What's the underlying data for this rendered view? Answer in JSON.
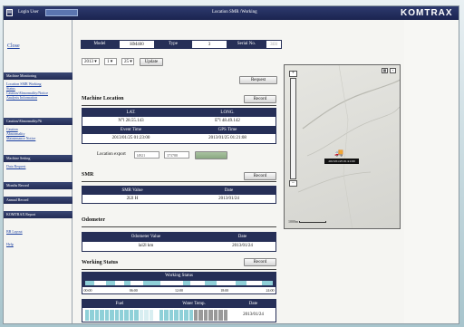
{
  "topbar": {
    "login_label": "Login User",
    "user_value": "",
    "title": "Location SMR /Working",
    "logo": "KOMTRAX"
  },
  "sidebar": {
    "close": "Close",
    "sections": [
      {
        "title": "Machine Monitoring",
        "links": [
          "Location SMR Working",
          "Status",
          "Caution/Abnormality/Notice",
          "Analysis Information"
        ]
      },
      {
        "title": "Caution/Abnormality/Ni",
        "links": [
          "Caution",
          "Abnormality",
          "Maintenance Notice"
        ]
      },
      {
        "title": "Machine Setting",
        "links": [
          "Data Request"
        ]
      },
      {
        "title": "Months Record",
        "links": []
      },
      {
        "title": "Annual Record",
        "links": []
      },
      {
        "title": "KOMTRAX Report",
        "links": []
      }
    ],
    "bottom_links": [
      "BB Layout",
      "Help"
    ]
  },
  "machine": {
    "model_label": "Model",
    "model_value": "HM400",
    "type_label": "Type",
    "type_value": "3",
    "serial_label": "Serial No.",
    "serial_value": "3l3l"
  },
  "date_picker": {
    "year": "2013",
    "month": "1",
    "day": "25",
    "update": "Update"
  },
  "request_button": "Request",
  "location": {
    "title": "Machine Location",
    "record": "Record",
    "lat_label": "LAT.",
    "long_label": "LONG.",
    "lat_value": "N°l 28.55.143",
    "long_value": "E°l 48.49.142",
    "event_label": "Event Time",
    "gps_label": "GPS Time",
    "event_value": "2013/01/25 01:23:00",
    "gps_value": "2013/01/25 01:21:08",
    "export_label": "Location export",
    "export_input1": "l4921",
    "export_input2": "373788",
    "export_button": ""
  },
  "smr": {
    "title": "SMR",
    "record": "Record",
    "value_label": "SMR Value",
    "date_label": "Date",
    "value": "2l2l H",
    "date": "2013/01/24"
  },
  "odometer": {
    "title": "Odometer",
    "value_label": "Odometer Value",
    "date_label": "Date",
    "value": "lal2l km",
    "date": "2013/01/24"
  },
  "working": {
    "title": "Working Status",
    "record": "Record",
    "status_label": "Working Status",
    "status_segments": [
      [
        0.0,
        0.05
      ],
      [
        0.11,
        0.16
      ],
      [
        0.21,
        0.24
      ],
      [
        0.31,
        0.4
      ],
      [
        0.52,
        0.56
      ],
      [
        0.64,
        0.7
      ],
      [
        0.8,
        0.86
      ],
      [
        0.94,
        1.0
      ]
    ],
    "time_ticks": [
      "00:00",
      "06:00",
      "12:00",
      "18:00",
      "24:00"
    ],
    "fuel_label": "Fuel",
    "water_label": "Water Temp.",
    "date_label": "Date",
    "fuel_level": 0.75,
    "water_level": 0.5,
    "date": "2013/01/24"
  },
  "map": {
    "marker_label": "2013/01/25 01:21:00",
    "scale_label": "1000m"
  },
  "colors": {
    "header_navy": "#262f57",
    "accent_cyan": "#8fd0d8",
    "link_blue": "#1a3fa0"
  }
}
